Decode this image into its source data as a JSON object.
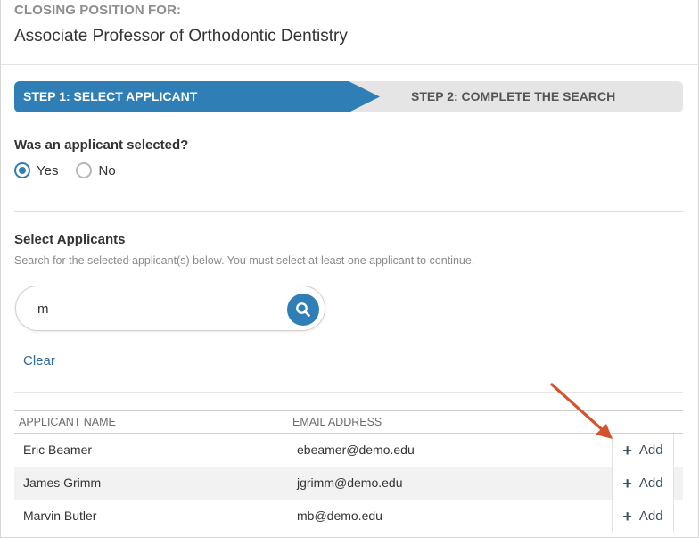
{
  "header": {
    "kicker": "CLOSING POSITION FOR:",
    "position_title": "Associate Professor of Orthodontic Dentistry"
  },
  "stepper": {
    "step1": "STEP 1: SELECT APPLICANT",
    "step2": "STEP 2: COMPLETE THE SEARCH",
    "active_step": 1
  },
  "question": {
    "label": "Was an applicant selected?",
    "options": [
      "Yes",
      "No"
    ],
    "selected": "Yes"
  },
  "select_applicants": {
    "title": "Select Applicants",
    "help": "Search for the selected applicant(s) below. You must select at least one applicant to continue."
  },
  "search": {
    "value": "m",
    "icon": "search-icon"
  },
  "clear_label": "Clear",
  "table": {
    "headers": [
      "APPLICANT NAME",
      "EMAIL ADDRESS"
    ],
    "add_label": "Add",
    "rows": [
      {
        "name": "Eric Beamer",
        "email": "ebeamer@demo.edu"
      },
      {
        "name": "James Grimm",
        "email": "jgrimm@demo.edu"
      },
      {
        "name": "Marvin Butler",
        "email": "mb@demo.edu"
      }
    ]
  },
  "colors": {
    "accent": "#2f7fb6",
    "annotation_arrow": "#d4532d"
  }
}
